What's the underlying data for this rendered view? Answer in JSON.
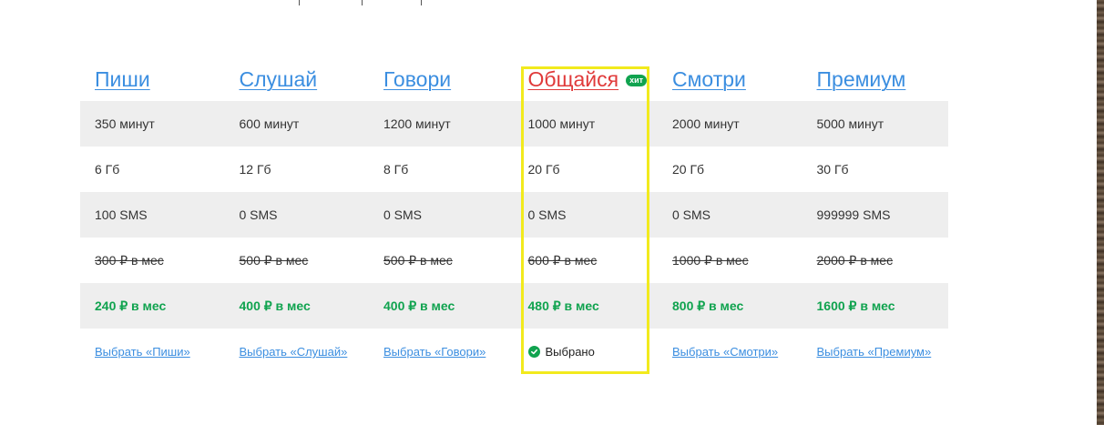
{
  "tariffs": [
    {
      "name": "Пиши",
      "minutes": "350 минут",
      "data": "6 Гб",
      "sms": "100 SMS",
      "old_price": "300 ₽ в мес",
      "new_price": "240 ₽  в мес",
      "action": "Выбрать «Пиши»"
    },
    {
      "name": "Слушай",
      "minutes": "600 минут",
      "data": "12 Гб",
      "sms": "0 SMS",
      "old_price": "500 ₽ в мес",
      "new_price": "400 ₽  в мес",
      "action": "Выбрать «Слушай»"
    },
    {
      "name": "Говори",
      "minutes": "1200 минут",
      "data": "8 Гб",
      "sms": "0 SMS",
      "old_price": "500 ₽ в мес",
      "new_price": "400 ₽  в мес",
      "action": "Выбрать «Говори»"
    },
    {
      "name": "Общайся",
      "badge": "хит",
      "minutes": "1000 минут",
      "data": "20 Гб",
      "sms": "0 SMS",
      "old_price": "600 ₽ в мес",
      "new_price": "480 ₽  в мес",
      "action": "Выбрано",
      "selected": true
    },
    {
      "name": "Смотри",
      "minutes": "2000 минут",
      "data": "20 Гб",
      "sms": "0 SMS",
      "old_price": "1000 ₽ в мес",
      "new_price": "800 ₽  в мес",
      "action": "Выбрать «Смотри»"
    },
    {
      "name": "Премиум",
      "minutes": "5000 минут",
      "data": "30 Гб",
      "sms": "999999 SMS",
      "old_price": "2000 ₽ в мес",
      "new_price": "1600 ₽  в мес",
      "action": "Выбрать «Премиум»"
    }
  ],
  "icons": {
    "selected": "check-circle-icon"
  },
  "colors": {
    "link": "#3b8ee0",
    "hot": "#e03a3a",
    "price": "#10a34f",
    "highlight": "#f2ea1d",
    "row_shade": "#eeeeee"
  }
}
